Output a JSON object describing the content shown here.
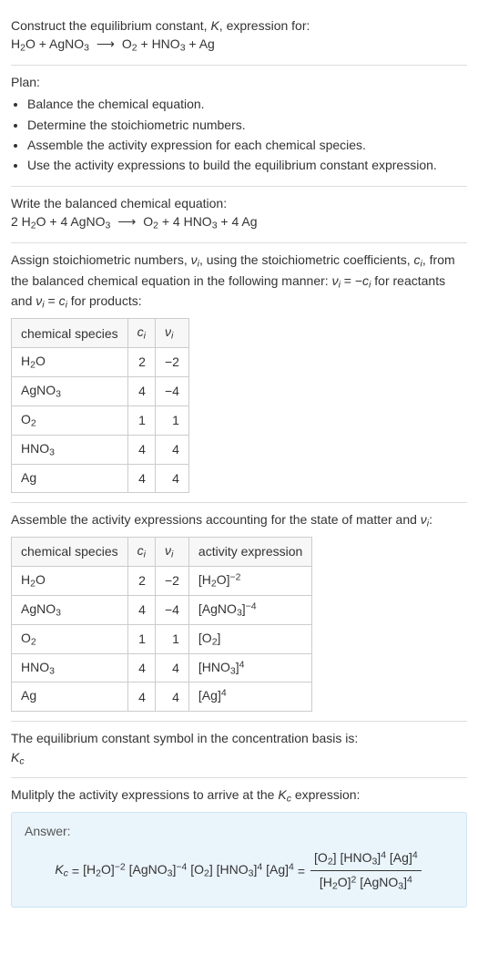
{
  "intro": {
    "line1": "Construct the equilibrium constant, ",
    "Ksym": "K",
    "line1b": ", expression for:",
    "unbalanced_lhs1": "H",
    "unbalanced_lhs1_sub": "2",
    "unbalanced_lhs2": "O + AgNO",
    "unbalanced_lhs2_sub": "3",
    "arrow": "⟶",
    "unbalanced_rhs1": "O",
    "unbalanced_rhs1_sub": "2",
    "unbalanced_rhs2": " + HNO",
    "unbalanced_rhs2_sub": "3",
    "unbalanced_rhs3": " + Ag"
  },
  "plan": {
    "title": "Plan:",
    "items": [
      "Balance the chemical equation.",
      "Determine the stoichiometric numbers.",
      "Assemble the activity expression for each chemical species.",
      "Use the activity expressions to build the equilibrium constant expression."
    ]
  },
  "balanced": {
    "title": "Write the balanced chemical equation:",
    "c1": "2 H",
    "c1s": "2",
    "c2": "O + 4 AgNO",
    "c2s": "3",
    "arrow": "⟶",
    "c3": "O",
    "c3s": "2",
    "c4": " + 4 HNO",
    "c4s": "3",
    "c5": " + 4 Ag"
  },
  "stoich": {
    "intro_a": "Assign stoichiometric numbers, ",
    "nu": "ν",
    "nu_sub": "i",
    "intro_b": ", using the stoichiometric coefficients, ",
    "c": "c",
    "c_sub": "i",
    "intro_c": ", from the balanced chemical equation in the following manner: ",
    "rule_react_a": "ν",
    "rule_react_b": " = −",
    "rule_react_c": "c",
    "rule_react_d": " for reactants and ",
    "rule_prod_a": "ν",
    "rule_prod_b": " = ",
    "rule_prod_c": "c",
    "rule_prod_d": " for products:",
    "headers": {
      "species": "chemical species",
      "ci": "c",
      "ci_sub": "i",
      "vi": "ν",
      "vi_sub": "i"
    },
    "rows": [
      {
        "sp_a": "H",
        "sp_as": "2",
        "sp_b": "O",
        "ci": "2",
        "vi": "−2"
      },
      {
        "sp_a": "AgNO",
        "sp_as": "3",
        "sp_b": "",
        "ci": "4",
        "vi": "−4"
      },
      {
        "sp_a": "O",
        "sp_as": "2",
        "sp_b": "",
        "ci": "1",
        "vi": "1"
      },
      {
        "sp_a": "HNO",
        "sp_as": "3",
        "sp_b": "",
        "ci": "4",
        "vi": "4"
      },
      {
        "sp_a": "Ag",
        "sp_as": "",
        "sp_b": "",
        "ci": "4",
        "vi": "4"
      }
    ]
  },
  "activity": {
    "intro_a": "Assemble the activity expressions accounting for the state of matter and ",
    "nu": "ν",
    "nu_sub": "i",
    "intro_b": ":",
    "headers": {
      "species": "chemical species",
      "ci": "c",
      "ci_sub": "i",
      "vi": "ν",
      "vi_sub": "i",
      "act": "activity expression"
    },
    "rows": [
      {
        "sp_a": "H",
        "sp_as": "2",
        "sp_b": "O",
        "ci": "2",
        "vi": "−2",
        "act_a": "[H",
        "act_as": "2",
        "act_b": "O]",
        "act_exp": "−2"
      },
      {
        "sp_a": "AgNO",
        "sp_as": "3",
        "sp_b": "",
        "ci": "4",
        "vi": "−4",
        "act_a": "[AgNO",
        "act_as": "3",
        "act_b": "]",
        "act_exp": "−4"
      },
      {
        "sp_a": "O",
        "sp_as": "2",
        "sp_b": "",
        "ci": "1",
        "vi": "1",
        "act_a": "[O",
        "act_as": "2",
        "act_b": "]",
        "act_exp": ""
      },
      {
        "sp_a": "HNO",
        "sp_as": "3",
        "sp_b": "",
        "ci": "4",
        "vi": "4",
        "act_a": "[HNO",
        "act_as": "3",
        "act_b": "]",
        "act_exp": "4"
      },
      {
        "sp_a": "Ag",
        "sp_as": "",
        "sp_b": "",
        "ci": "4",
        "vi": "4",
        "act_a": "[Ag",
        "act_as": "",
        "act_b": "]",
        "act_exp": "4"
      }
    ]
  },
  "ksymbol": {
    "line": "The equilibrium constant symbol in the concentration basis is:",
    "K": "K",
    "Ksub": "c"
  },
  "multiply": {
    "line_a": "Mulitply the activity expressions to arrive at the ",
    "K": "K",
    "Ksub": "c",
    "line_b": " expression:"
  },
  "answer": {
    "label": "Answer:",
    "Kc_K": "K",
    "Kc_sub": "c",
    "eq": " = ",
    "t1": "[H",
    "t1s": "2",
    "t1b": "O]",
    "t1e": "−2",
    "t2": "[AgNO",
    "t2s": "3",
    "t2b": "]",
    "t2e": "−4",
    "t3": "[O",
    "t3s": "2",
    "t3b": "]",
    "t3e": "",
    "t4": "[HNO",
    "t4s": "3",
    "t4b": "]",
    "t4e": "4",
    "t5": "[Ag",
    "t5s": "",
    "t5b": "]",
    "t5e": "4",
    "eq2": " = ",
    "num1": "[O",
    "num1s": "2",
    "num1b": "]",
    "num1e": "",
    "num2": "[HNO",
    "num2s": "3",
    "num2b": "]",
    "num2e": "4",
    "num3": "[Ag",
    "num3s": "",
    "num3b": "]",
    "num3e": "4",
    "den1": "[H",
    "den1s": "2",
    "den1b": "O]",
    "den1e": "2",
    "den2": "[AgNO",
    "den2s": "3",
    "den2b": "]",
    "den2e": "4"
  }
}
